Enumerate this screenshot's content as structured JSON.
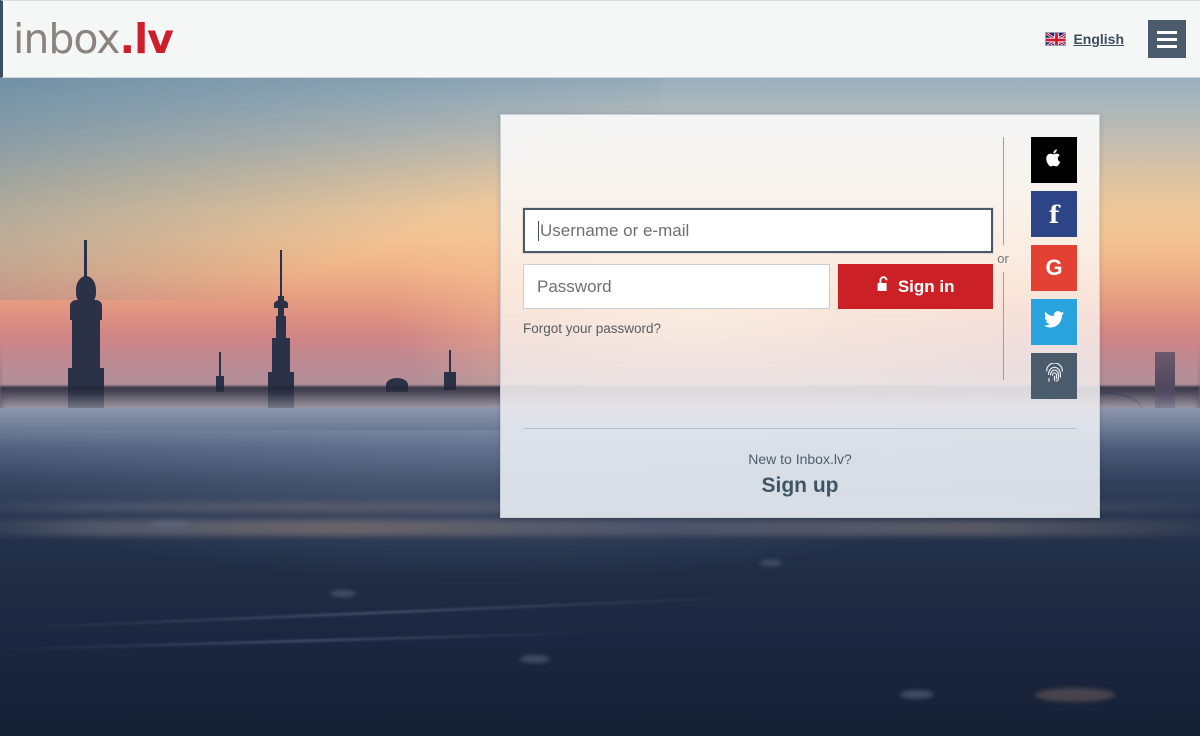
{
  "header": {
    "logo_word": "inbox",
    "logo_tld": ".lv",
    "language": {
      "label": "English",
      "flag_icon": "uk-flag-icon"
    },
    "menu_icon": "hamburger-menu-icon",
    "background": "#f5f6f6"
  },
  "login": {
    "username": {
      "value": "",
      "placeholder": "Username or e-mail",
      "focused": true
    },
    "password": {
      "value": "",
      "placeholder": "Password"
    },
    "signin_label": "Sign in",
    "signin_icon": "unlock-padlock-icon",
    "signin_color": "#cc2027",
    "forgot_label": "Forgot your password?",
    "or_label": "or",
    "social": [
      {
        "name": "apple",
        "icon": "apple-icon",
        "glyph": "",
        "color": "#000000"
      },
      {
        "name": "facebook",
        "icon": "facebook-icon",
        "glyph": "f",
        "color": "#2d4486"
      },
      {
        "name": "google",
        "icon": "google-icon",
        "glyph": "G",
        "color": "#e34133"
      },
      {
        "name": "twitter",
        "icon": "twitter-icon",
        "glyph": "",
        "color": "#28a3de"
      },
      {
        "name": "fingerprint",
        "icon": "fingerprint-icon",
        "glyph": "",
        "color": "#4a5c6b"
      }
    ],
    "signup_prompt": "New to Inbox.lv?",
    "signup_label": "Sign up"
  },
  "background": {
    "scene": "riga-skyline-sunset-frozen-river"
  }
}
